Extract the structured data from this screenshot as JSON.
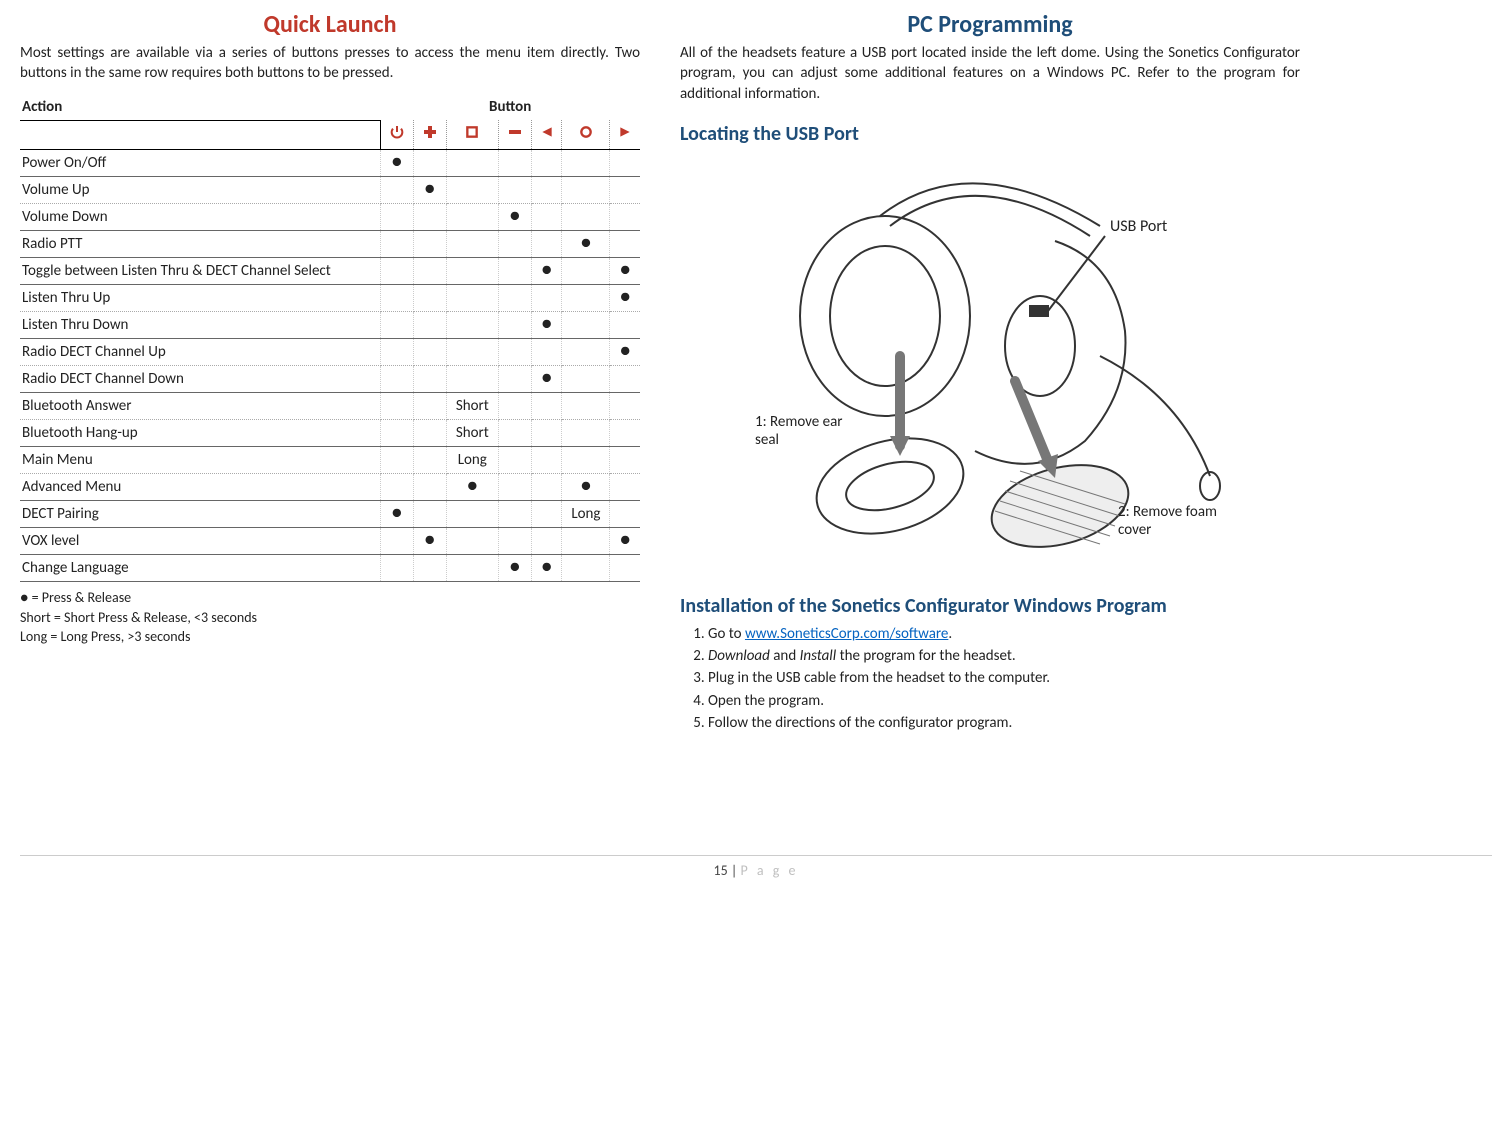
{
  "left": {
    "title": "Quick Launch",
    "intro": "Most settings are available via a series of buttons presses to access the menu item directly. Two buttons in the same row requires both buttons to be pressed.",
    "table": {
      "header_action": "Action",
      "header_button": "Button",
      "icons": [
        "power",
        "plus",
        "square",
        "minus",
        "left",
        "circle",
        "right"
      ],
      "rows": [
        {
          "label": "Power On/Off",
          "cells": [
            "●",
            "",
            "",
            "",
            "",
            "",
            ""
          ],
          "solid": true
        },
        {
          "label": "Volume Up",
          "cells": [
            "",
            "●",
            "",
            "",
            "",
            "",
            ""
          ],
          "solid": false
        },
        {
          "label": "Volume Down",
          "cells": [
            "",
            "",
            "",
            "●",
            "",
            "",
            ""
          ],
          "solid": true
        },
        {
          "label": "Radio PTT",
          "cells": [
            "",
            "",
            "",
            "",
            "",
            "●",
            ""
          ],
          "solid": true
        },
        {
          "label": "Toggle between Listen Thru & DECT Channel Select",
          "cells": [
            "",
            "",
            "",
            "",
            "●",
            "",
            "●"
          ],
          "solid": true
        },
        {
          "label": "Listen Thru Up",
          "cells": [
            "",
            "",
            "",
            "",
            "",
            "",
            "●"
          ],
          "solid": false
        },
        {
          "label": "Listen Thru Down",
          "cells": [
            "",
            "",
            "",
            "",
            "●",
            "",
            ""
          ],
          "solid": true
        },
        {
          "label": "Radio DECT Channel Up",
          "cells": [
            "",
            "",
            "",
            "",
            "",
            "",
            "●"
          ],
          "solid": false
        },
        {
          "label": "Radio DECT Channel Down",
          "cells": [
            "",
            "",
            "",
            "",
            "●",
            "",
            ""
          ],
          "solid": true
        },
        {
          "label": "Bluetooth Answer",
          "cells": [
            "",
            "",
            "Short",
            "",
            "",
            "",
            ""
          ],
          "solid": false
        },
        {
          "label": "Bluetooth Hang-up",
          "cells": [
            "",
            "",
            "Short",
            "",
            "",
            "",
            ""
          ],
          "solid": true
        },
        {
          "label": "Main Menu",
          "cells": [
            "",
            "",
            "Long",
            "",
            "",
            "",
            ""
          ],
          "solid": false
        },
        {
          "label": "Advanced Menu",
          "cells": [
            "",
            "",
            "●",
            "",
            "",
            "●",
            ""
          ],
          "solid": true
        },
        {
          "label": "DECT Pairing",
          "cells": [
            "●",
            "",
            "",
            "",
            "",
            "Long",
            ""
          ],
          "solid": true
        },
        {
          "label": "VOX level",
          "cells": [
            "",
            "●",
            "",
            "",
            "",
            "",
            "●"
          ],
          "solid": true
        },
        {
          "label": "Change Language",
          "cells": [
            "",
            "",
            "",
            "●",
            "●",
            "",
            ""
          ],
          "solid": true
        }
      ]
    },
    "legend": {
      "l1": "● = Press & Release",
      "l2": "Short = Short Press & Release, <3 seconds",
      "l3": "Long = Long Press, >3 seconds"
    }
  },
  "right": {
    "title": "PC Programming",
    "intro": "All of the headsets feature a USB port located inside the left dome. Using the Sonetics Configurator program, you can adjust some additional features on a Windows PC. Refer to the program for additional information.",
    "h_locating": "Locating the USB Port",
    "img_labels": {
      "usb": "USB Port",
      "l1": "1: Remove ear seal",
      "l2": "2: Remove foam cover"
    },
    "h_install": "Installation of the Sonetics Configurator Windows Program",
    "steps": {
      "s1a": "Go to ",
      "s1_link": "www.SoneticsCorp.com/software",
      "s1b": ".",
      "s2a": "Download",
      "s2b": " and ",
      "s2c": "Install",
      "s2d": " the program for the headset.",
      "s3": "Plug in the USB cable from the headset to the computer.",
      "s4": "Open the program.",
      "s5": "Follow the directions of the configurator program."
    }
  },
  "footer": {
    "num": "15",
    "sep": " | ",
    "page": "P a g e"
  }
}
